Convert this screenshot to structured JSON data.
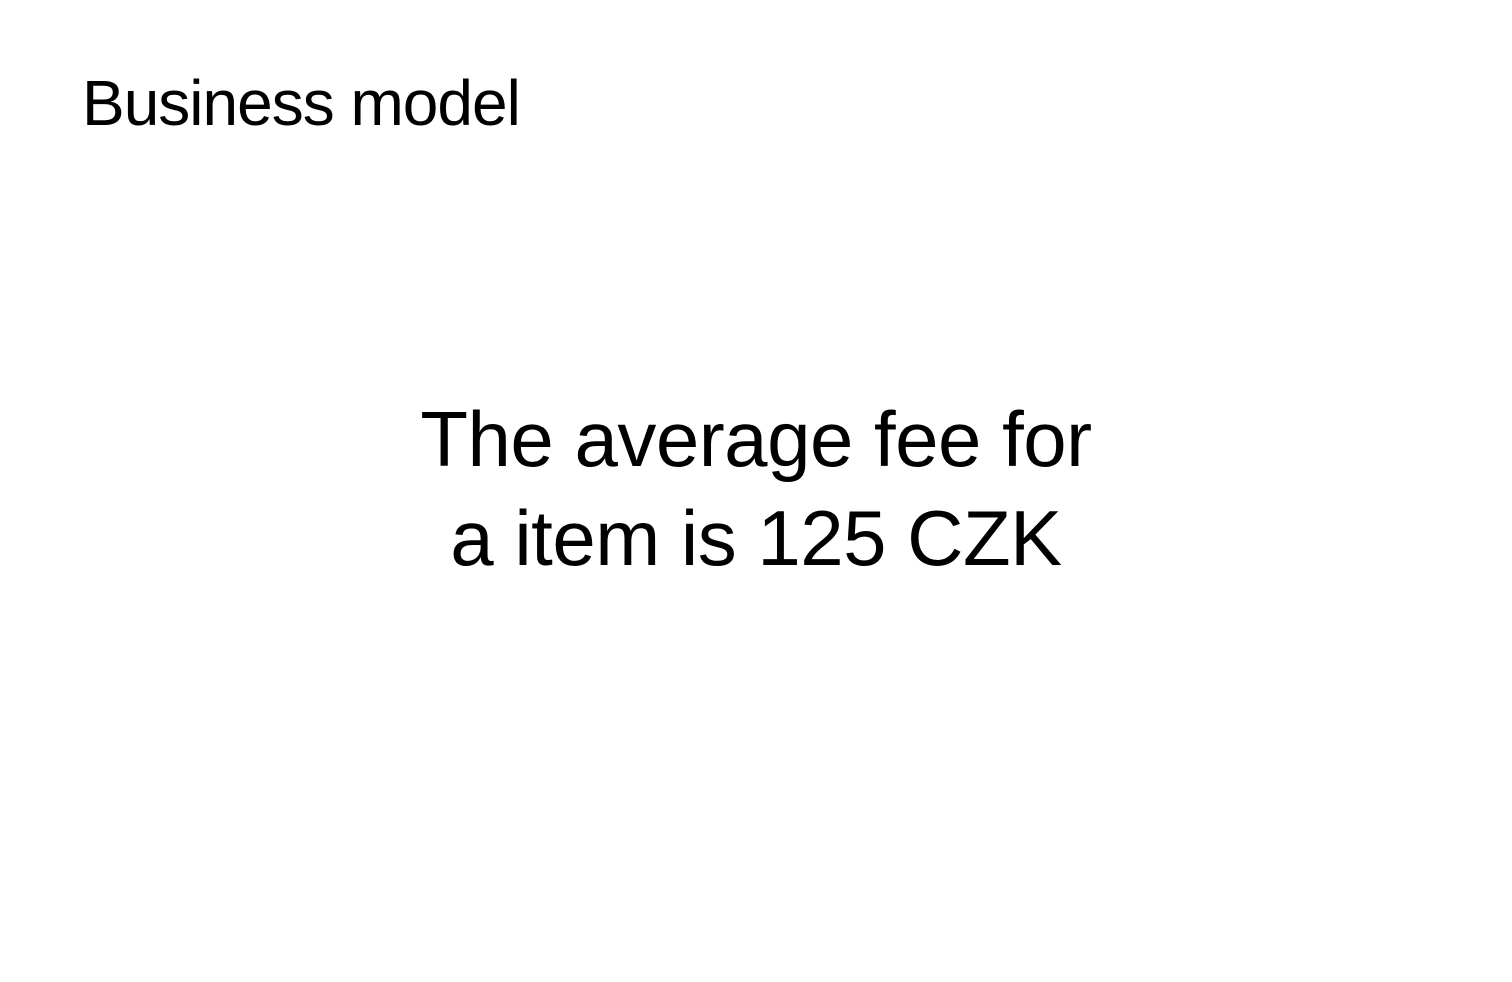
{
  "slide": {
    "title": "Business model",
    "statement": {
      "lines": [
        "The average fee for",
        "a item is 125 CZK"
      ]
    }
  },
  "colors": {
    "background": "#ffffff",
    "text": "#000000"
  }
}
